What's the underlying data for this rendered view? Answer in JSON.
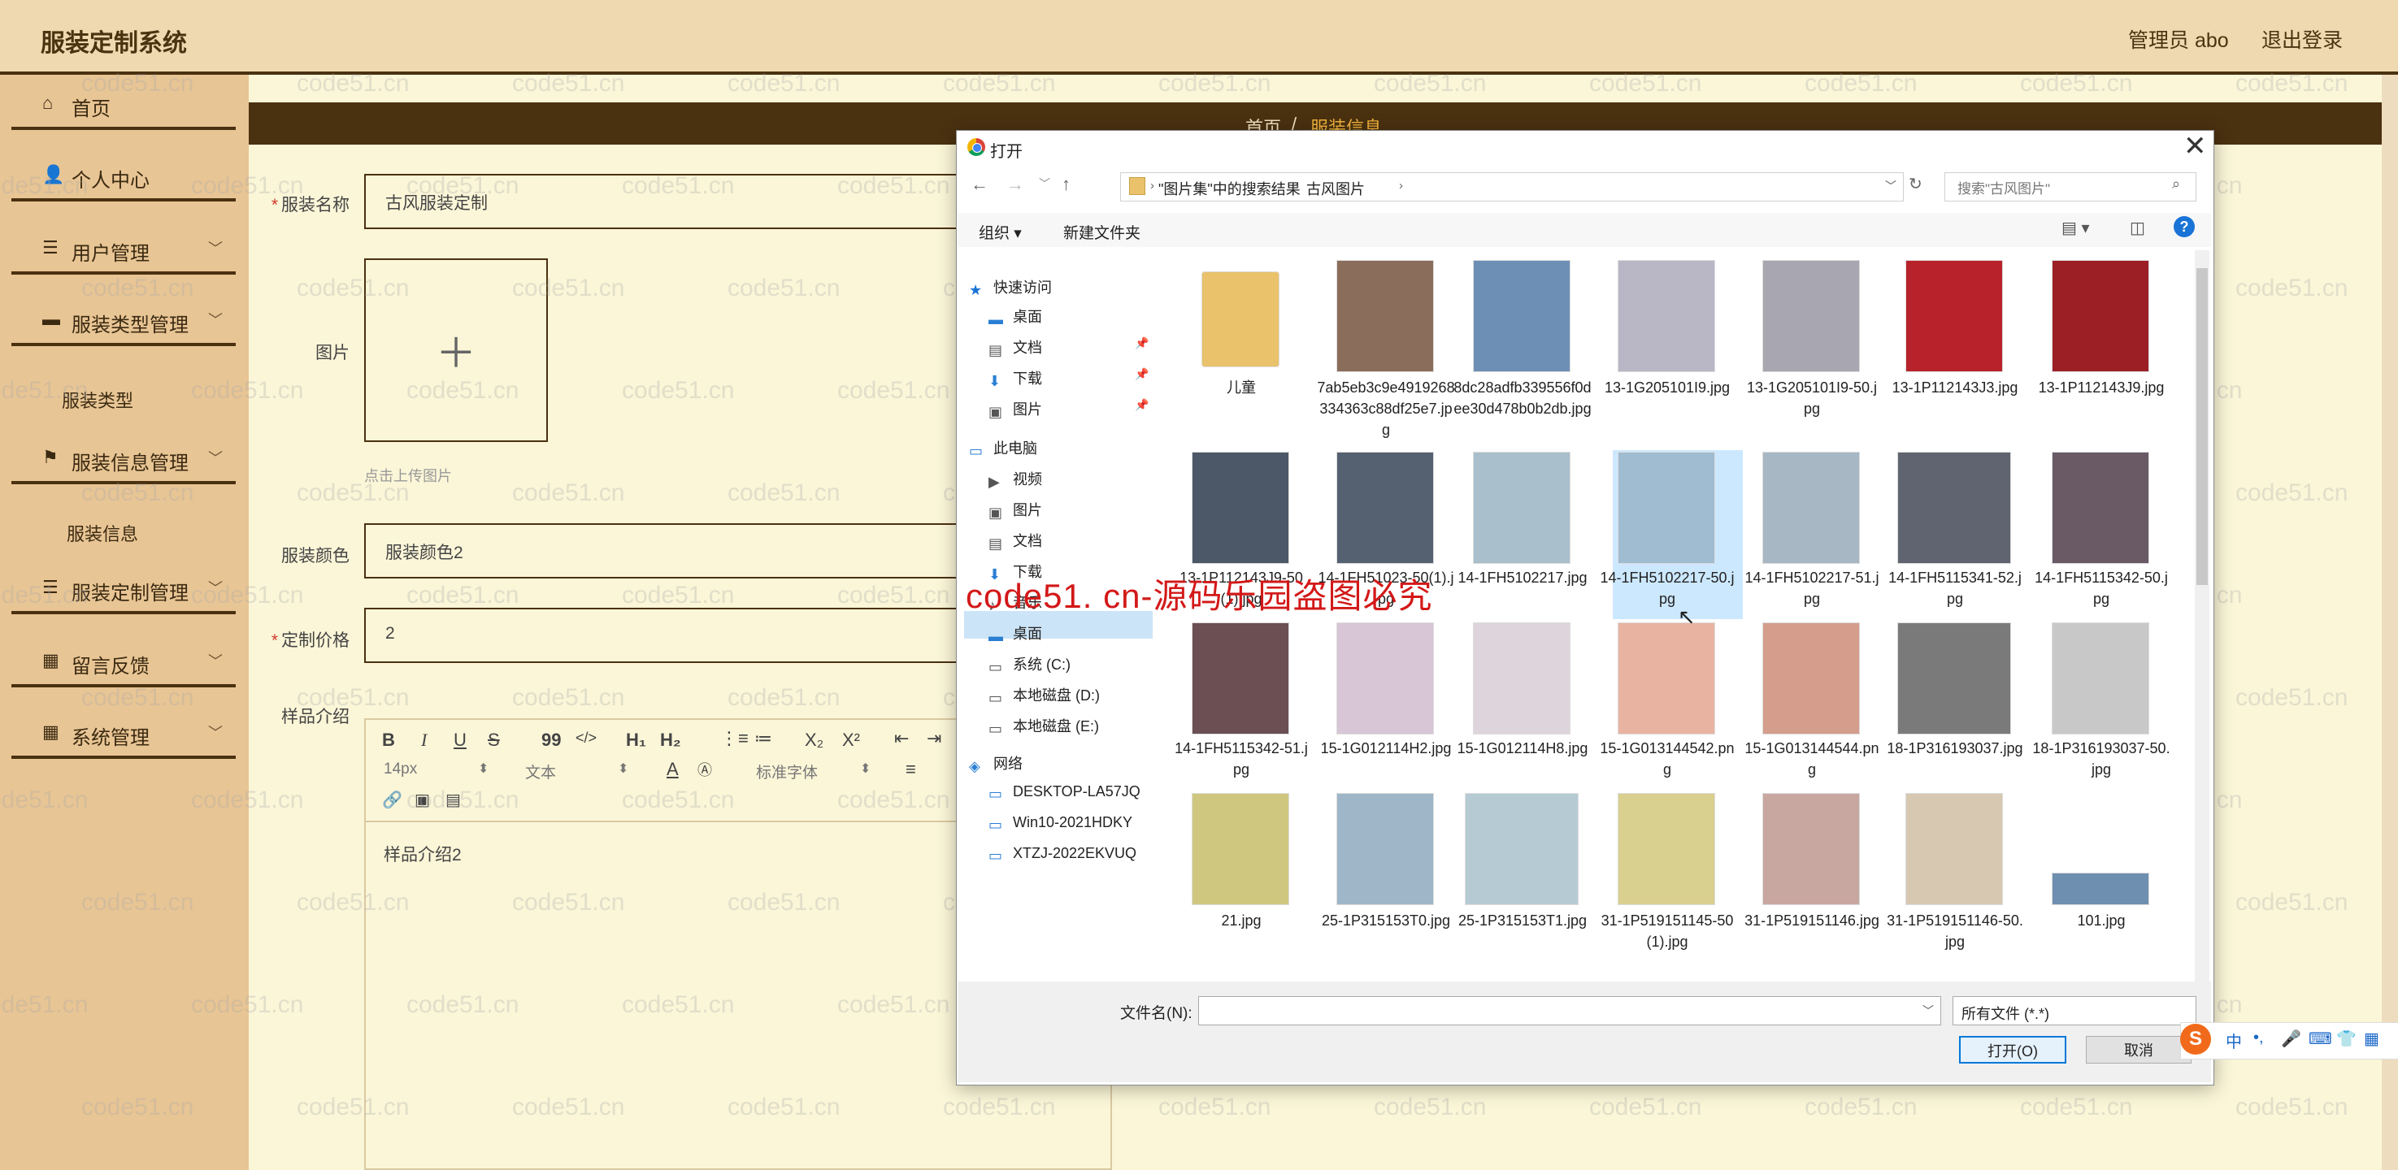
{
  "app": {
    "title": "服装定制系统",
    "admin_label": "管理员 abo",
    "logout_label": "退出登录"
  },
  "sidebar": {
    "items": [
      {
        "label": "首页",
        "icon": "home-icon"
      },
      {
        "label": "个人中心",
        "icon": "user-icon"
      },
      {
        "label": "用户管理",
        "icon": "list-icon"
      },
      {
        "label": "服装类型管理",
        "icon": "briefcase-icon"
      },
      {
        "label": "服装信息管理",
        "icon": "flag-icon"
      },
      {
        "label": "服装定制管理",
        "icon": "list-icon"
      },
      {
        "label": "留言反馈",
        "icon": "grid-icon"
      },
      {
        "label": "系统管理",
        "icon": "grid-icon"
      }
    ],
    "sub_items": [
      "服装类型",
      "服装信息"
    ]
  },
  "breadcrumb": {
    "home": "首页",
    "sep": "/",
    "current": "服装信息"
  },
  "form": {
    "name_label": "服装名称",
    "name_value": "古风服装定制",
    "image_label": "图片",
    "upload_hint": "点击上传图片",
    "color_label": "服装颜色",
    "color_value": "服装颜色2",
    "price_label": "定制价格",
    "price_value": "2",
    "sample_label": "样品介绍",
    "sample_value": "样品介绍2"
  },
  "editor": {
    "bold": "B",
    "italic": "I",
    "underline": "U",
    "strike": "S",
    "quote": "99",
    "code": "</>",
    "h1": "H₁",
    "h2": "H₂",
    "ol": "⋮≡",
    "ul": "≔",
    "sub": "X₂",
    "sup": "X²",
    "outdent": "⇤",
    "indent": "⇥",
    "font_size": "14px",
    "text_style": "文本",
    "font_family": "标准字体",
    "align": "≡"
  },
  "dialog": {
    "title": "打开",
    "path_parts": [
      "\"图片集\"中的搜索结果",
      "古风图片"
    ],
    "search_placeholder": "搜索\"古风图片\"",
    "organize": "组织 ▾",
    "new_folder": "新建文件夹",
    "tree": [
      {
        "label": "快速访问",
        "icon": "star-icon"
      },
      {
        "label": "桌面",
        "icon": "desktop-icon"
      },
      {
        "label": "文档",
        "icon": "document-icon"
      },
      {
        "label": "下载",
        "icon": "download-icon"
      },
      {
        "label": "图片",
        "icon": "picture-icon"
      },
      {
        "label": "此电脑",
        "icon": "computer-icon"
      },
      {
        "label": "视频",
        "icon": "video-icon"
      },
      {
        "label": "图片",
        "icon": "picture-icon"
      },
      {
        "label": "文档",
        "icon": "document-icon"
      },
      {
        "label": "下载",
        "icon": "download-icon"
      },
      {
        "label": "音乐",
        "icon": "music-icon"
      },
      {
        "label": "桌面",
        "icon": "desktop-icon"
      },
      {
        "label": "系统 (C:)",
        "icon": "drive-icon"
      },
      {
        "label": "本地磁盘 (D:)",
        "icon": "drive-icon"
      },
      {
        "label": "本地磁盘 (E:)",
        "icon": "drive-icon"
      },
      {
        "label": "网络",
        "icon": "network-icon"
      },
      {
        "label": "DESKTOP-LA57JQ",
        "icon": "computer-icon"
      },
      {
        "label": "Win10-2021HDKY",
        "icon": "computer-icon"
      },
      {
        "label": "XTZJ-2022EKVUQ",
        "icon": "computer-icon"
      }
    ],
    "files": [
      {
        "name": "儿童",
        "color": "#e9c26b"
      },
      {
        "name": "7ab5eb3c9e4919268334363c88df25e7.jpg",
        "color": "#8a6d5a"
      },
      {
        "name": "8dc28adfb339556f0dee30d478b0b2db.jpg",
        "color": "#6d8fb5"
      },
      {
        "name": "13-1G205101I9.jpg",
        "color": "#b9b6c6"
      },
      {
        "name": "13-1G205101I9-50.jpg",
        "color": "#a8a6b0"
      },
      {
        "name": "13-1P112143J3.jpg",
        "color": "#b8222a"
      },
      {
        "name": "13-1P112143J9.jpg",
        "color": "#9c1f26"
      },
      {
        "name": "13-1P112143J9-50(1).jpg",
        "color": "#4c5868"
      },
      {
        "name": "14-1FH51023-50(1).jpg",
        "color": "#556070"
      },
      {
        "name": "14-1FH5102217.jpg",
        "color": "#a9c0cc"
      },
      {
        "name": "14-1FH5102217-50.jpg",
        "color": "#9fbcd0"
      },
      {
        "name": "14-1FH5102217-51.jpg",
        "color": "#a7b7c4"
      },
      {
        "name": "14-1FH5115341-52.jpg",
        "color": "#5f6470"
      },
      {
        "name": "14-1FH5115342-50.jpg",
        "color": "#6a5a66"
      },
      {
        "name": "14-1FH5115342-51.jpg",
        "color": "#6b4f52"
      },
      {
        "name": "15-1G012114H2.jpg",
        "color": "#d8c6d6"
      },
      {
        "name": "15-1G012114H8.jpg",
        "color": "#ddd4dc"
      },
      {
        "name": "15-1G013144542.png",
        "color": "#e9b3a2"
      },
      {
        "name": "15-1G013144544.png",
        "color": "#d49d8c"
      },
      {
        "name": "18-1P316193037.jpg",
        "color": "#7a7a7a"
      },
      {
        "name": "18-1P316193037-50.jpg",
        "color": "#c8c8c8"
      },
      {
        "name": "21.jpg",
        "color": "#cfc77f"
      },
      {
        "name": "25-1P315153T0.jpg",
        "color": "#9eb6c8"
      },
      {
        "name": "25-1P315153T1.jpg",
        "color": "#b6cad4"
      },
      {
        "name": "31-1P519151145-50 (1).jpg",
        "color": "#d9cf8e"
      },
      {
        "name": "31-1P519151146.jpg",
        "color": "#c9a7a1"
      },
      {
        "name": "31-1P519151146-50.jpg",
        "color": "#d7c8b2"
      },
      {
        "name": "101.jpg",
        "color": "#6f8fb0"
      }
    ],
    "filename_label": "文件名(N):",
    "filter_value": "所有文件 (*.*)",
    "open_label": "打开(O)",
    "cancel_label": "取消"
  },
  "watermark": {
    "text": "code51.cn",
    "big_text": "code51. cn-源码乐园盗图必究"
  },
  "ime": {
    "logo": "S",
    "items": [
      "中",
      "•,",
      "🎤",
      "⌨",
      "👕",
      "▦"
    ]
  }
}
